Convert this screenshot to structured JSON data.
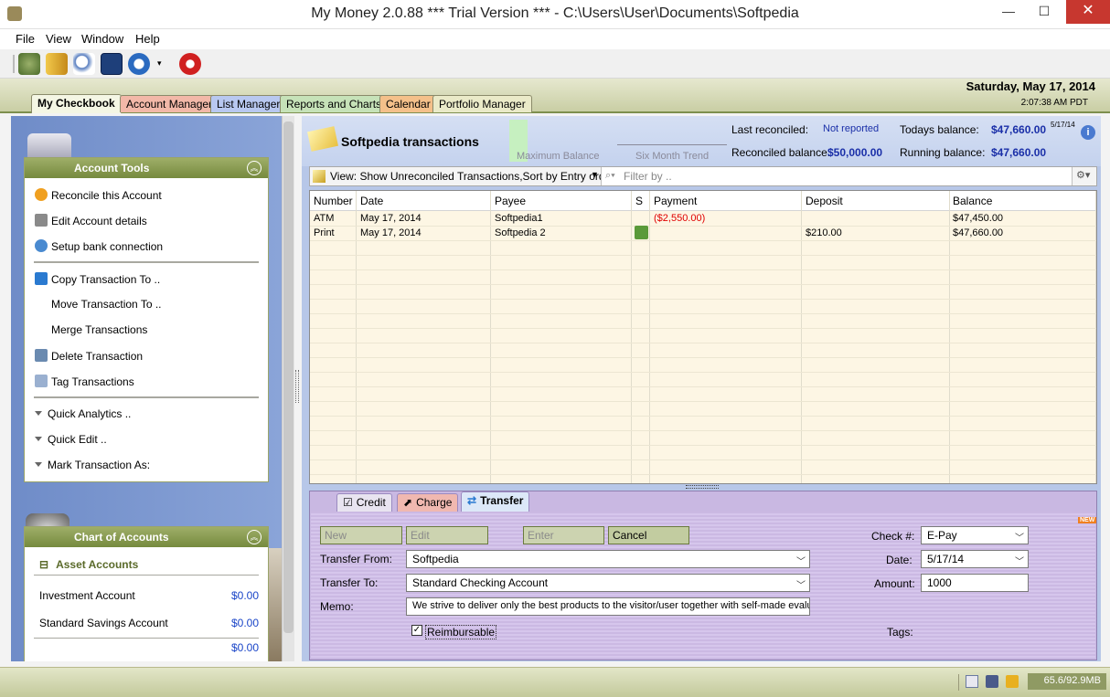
{
  "window": {
    "title": "My Money 2.0.88 *** Trial Version *** - C:\\Users\\User\\Documents\\Softpedia",
    "minimize": "—",
    "maximize": "☐",
    "close": "✕"
  },
  "menu": [
    "File",
    "View",
    "Window",
    "Help"
  ],
  "tabs": [
    "My Checkbook",
    "Account Manager",
    "List Manager",
    "Reports and Charts",
    "Calendar",
    "Portfolio Manager"
  ],
  "datetime": {
    "date": "Saturday, May 17, 2014",
    "time": "2:07:38 AM PDT"
  },
  "sidebar": {
    "account_tools": {
      "title": "Account Tools",
      "items": [
        "Reconcile this Account",
        "Edit Account details",
        "Setup bank connection",
        "Copy Transaction To ..",
        "Move Transaction To ..",
        "Merge Transactions",
        "Delete Transaction",
        "Tag Transactions",
        "Quick Analytics ..",
        "Quick Edit ..",
        "Mark Transaction As:"
      ]
    },
    "chart_of_accounts": {
      "title": "Chart of Accounts",
      "group": "Asset Accounts",
      "accounts": [
        {
          "name": "Investment Account",
          "value": "$0.00"
        },
        {
          "name": "Standard Savings Account",
          "value": "$0.00"
        }
      ],
      "total": "$0.00"
    }
  },
  "header": {
    "title": "Softpedia transactions",
    "max_balance_label": "Maximum Balance",
    "six_month_label": "Six Month Trend",
    "last_reconciled_label": "Last reconciled:",
    "last_reconciled_value": "Not reported",
    "reconciled_balance_label": "Reconciled balance:",
    "reconciled_balance_value": "$50,000.00",
    "todays_balance_label": "Todays balance:",
    "todays_balance_value": "$47,660.00",
    "todays_balance_date": "5/17/14",
    "running_balance_label": "Running balance:",
    "running_balance_value": "$47,660.00"
  },
  "viewbar": {
    "view_text": "View: Show Unreconciled Transactions,Sort by Entry order",
    "filter_placeholder": "Filter by .."
  },
  "grid": {
    "columns": [
      "Number",
      "Date",
      "Payee",
      "S",
      "Payment",
      "Deposit",
      "Balance"
    ],
    "rows": [
      {
        "number": "ATM",
        "date": "May 17, 2014",
        "payee": "Softpedia1",
        "payment": "($2,550.00)",
        "deposit": "",
        "balance": "$47,450.00"
      },
      {
        "number": "Print",
        "date": "May 17, 2014",
        "payee": "Softpedia 2",
        "payment": "",
        "deposit": "$210.00",
        "balance": "$47,660.00"
      }
    ]
  },
  "form": {
    "tabs": [
      "Credit",
      "Charge",
      "Transfer"
    ],
    "buttons": {
      "new": "New",
      "edit": "Edit",
      "enter": "Enter",
      "cancel": "Cancel"
    },
    "transfer_from_label": "Transfer From:",
    "transfer_from_value": "Softpedia",
    "transfer_to_label": "Transfer To:",
    "transfer_to_value": "Standard Checking Account",
    "memo_label": "Memo:",
    "memo_value": "We strive to deliver only the best products to the visitor/user together with self-made evalu",
    "reimbursable_label": "Reimbursable",
    "check_label": "Check #:",
    "check_value": "E-Pay",
    "date_label": "Date:",
    "date_value": "5/17/14",
    "amount_label": "Amount:",
    "amount_value": "1000",
    "tags_label": "Tags:",
    "new_badge": "NEW"
  },
  "status": {
    "memory": "65.6/92.9MB"
  },
  "colors": {
    "accent_green": "#758a3e",
    "link_blue": "#1a45c8",
    "negative_red": "#e00000"
  }
}
